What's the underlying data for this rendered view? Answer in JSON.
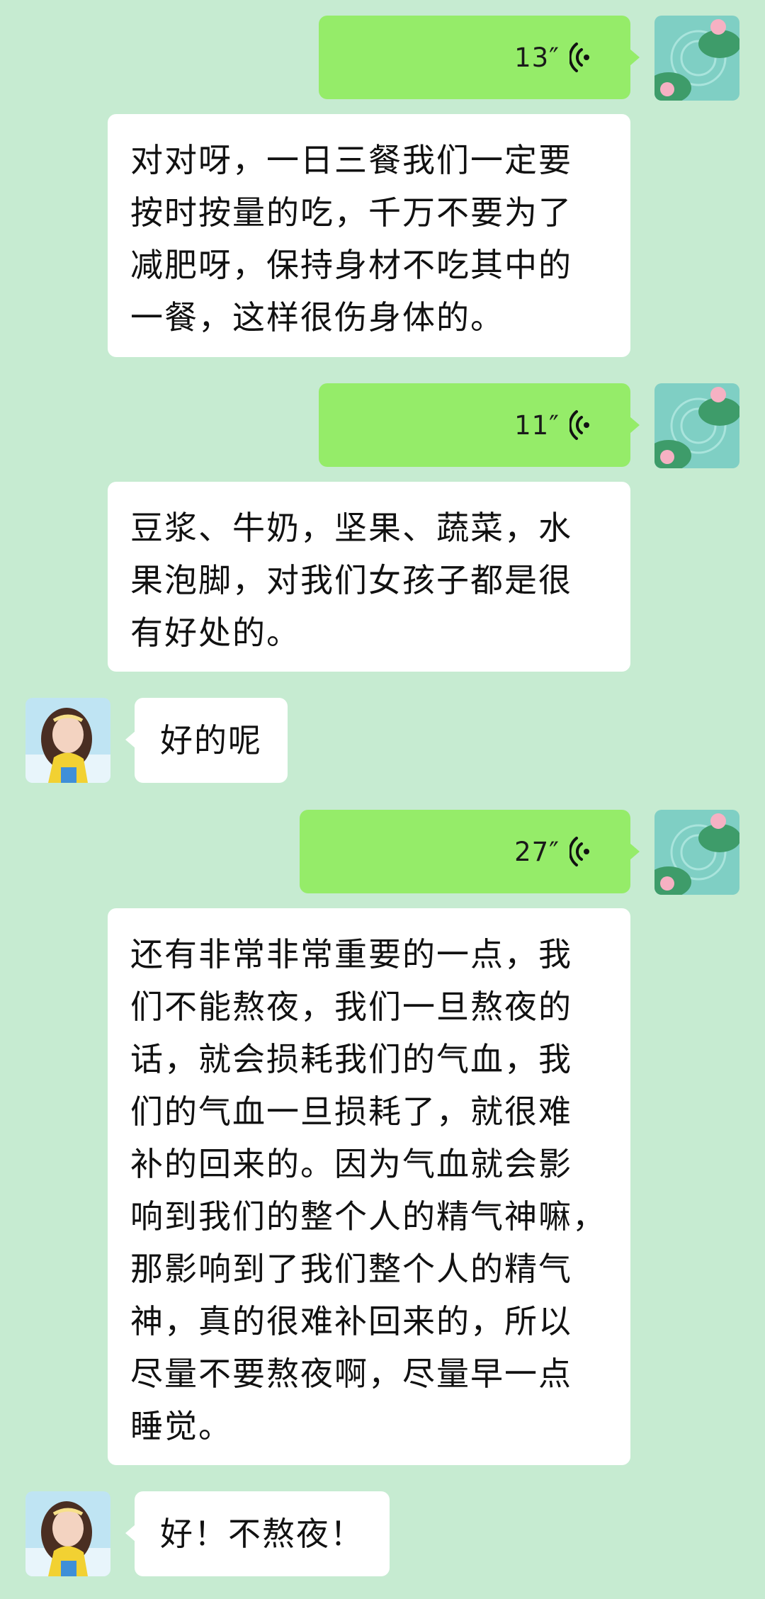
{
  "messages": [
    {
      "type": "voice",
      "sender": "self",
      "duration": "13″"
    },
    {
      "type": "text",
      "sender": "self",
      "text": "对对呀，一日三餐我们一定要\n按时按量的吃，千万不要为了\n减肥呀，保持身材不吃其中的\n一餐，这样很伤身体的。"
    },
    {
      "type": "voice",
      "sender": "self",
      "duration": "11″"
    },
    {
      "type": "text",
      "sender": "self",
      "text": "豆浆、牛奶，坚果、蔬菜，水\n果泡脚，对我们女孩子都是很\n有好处的。"
    },
    {
      "type": "text",
      "sender": "other",
      "text": "好的呢"
    },
    {
      "type": "voice",
      "sender": "self",
      "duration": "27″"
    },
    {
      "type": "text",
      "sender": "self",
      "text": "还有非常非常重要的一点，我\n们不能熬夜，我们一旦熬夜的\n话，就会损耗我们的气血，我\n们的气血一旦损耗了，就很难\n补的回来的。因为气血就会影\n响到我们的整个人的精气神嘛，\n那影响到了我们整个人的精气\n神，真的很难补回来的，所以\n尽量不要熬夜啊，尽量早一点\n睡觉。"
    },
    {
      "type": "text",
      "sender": "other",
      "text": "好！不熬夜！"
    }
  ],
  "colors": {
    "background": "#c6ebd1",
    "self_voice_bubble": "#95ec69",
    "text_bubble": "#ffffff"
  },
  "icons": {
    "voice": "voice-wave-icon",
    "self_avatar": "lotus-pond-avatar",
    "other_avatar": "girl-portrait-avatar"
  }
}
